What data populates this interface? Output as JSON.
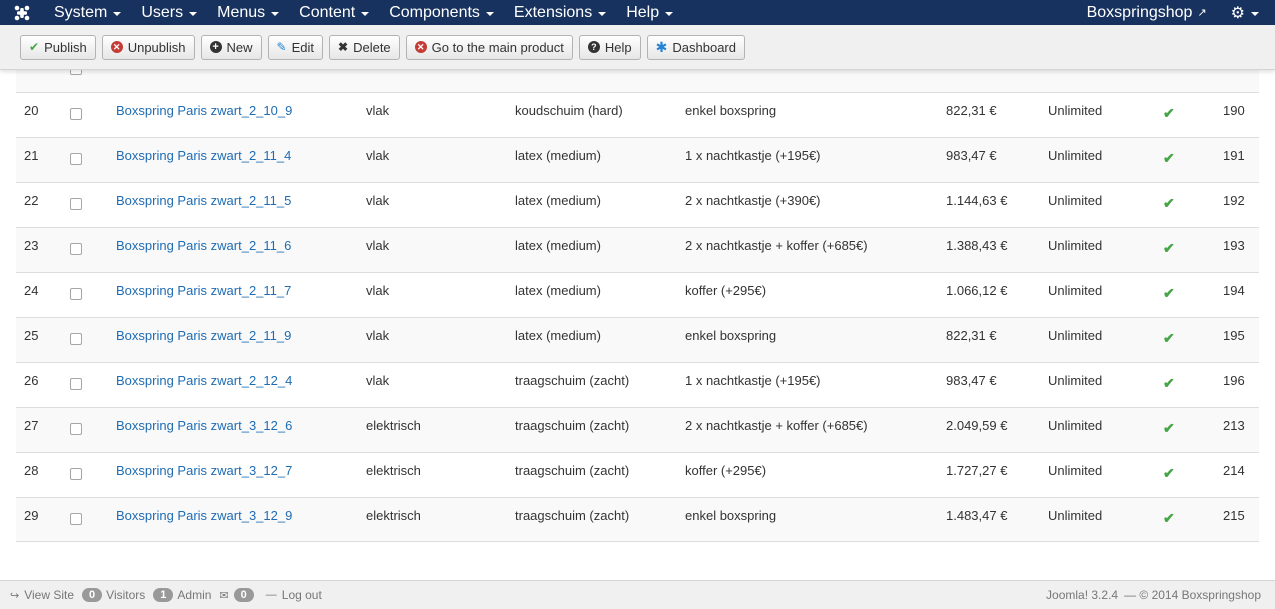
{
  "navbar": {
    "menus": [
      "System",
      "Users",
      "Menus",
      "Content",
      "Components",
      "Extensions",
      "Help"
    ],
    "site_name": "Boxspringshop"
  },
  "toolbar": {
    "publish": "Publish",
    "unpublish": "Unpublish",
    "new": "New",
    "edit": "Edit",
    "delete": "Delete",
    "main_product": "Go to the main product",
    "help": "Help",
    "dashboard": "Dashboard"
  },
  "table": {
    "rows": [
      {
        "num": "20",
        "name": "Boxspring Paris zwart_2_10_9",
        "f1": "vlak",
        "f2": "koudschuim (hard)",
        "f3": "enkel boxspring",
        "price": "822,31 €",
        "stock": "Unlimited",
        "id": "190"
      },
      {
        "num": "21",
        "name": "Boxspring Paris zwart_2_11_4",
        "f1": "vlak",
        "f2": "latex (medium)",
        "f3": "1 x nachtkastje (+195€)",
        "price": "983,47 €",
        "stock": "Unlimited",
        "id": "191"
      },
      {
        "num": "22",
        "name": "Boxspring Paris zwart_2_11_5",
        "f1": "vlak",
        "f2": "latex (medium)",
        "f3": "2 x nachtkastje (+390€)",
        "price": "1.144,63 €",
        "stock": "Unlimited",
        "id": "192"
      },
      {
        "num": "23",
        "name": "Boxspring Paris zwart_2_11_6",
        "f1": "vlak",
        "f2": "latex (medium)",
        "f3": "2 x nachtkastje + koffer (+685€)",
        "price": "1.388,43 €",
        "stock": "Unlimited",
        "id": "193"
      },
      {
        "num": "24",
        "name": "Boxspring Paris zwart_2_11_7",
        "f1": "vlak",
        "f2": "latex (medium)",
        "f3": "koffer (+295€)",
        "price": "1.066,12 €",
        "stock": "Unlimited",
        "id": "194"
      },
      {
        "num": "25",
        "name": "Boxspring Paris zwart_2_11_9",
        "f1": "vlak",
        "f2": "latex (medium)",
        "f3": "enkel boxspring",
        "price": "822,31 €",
        "stock": "Unlimited",
        "id": "195"
      },
      {
        "num": "26",
        "name": "Boxspring Paris zwart_2_12_4",
        "f1": "vlak",
        "f2": "traagschuim (zacht)",
        "f3": "1 x nachtkastje (+195€)",
        "price": "983,47 €",
        "stock": "Unlimited",
        "id": "196"
      },
      {
        "num": "27",
        "name": "Boxspring Paris zwart_3_12_6",
        "f1": "elektrisch",
        "f2": "traagschuim (zacht)",
        "f3": "2 x nachtkastje + koffer (+685€)",
        "price": "2.049,59 €",
        "stock": "Unlimited",
        "id": "213"
      },
      {
        "num": "28",
        "name": "Boxspring Paris zwart_3_12_7",
        "f1": "elektrisch",
        "f2": "traagschuim (zacht)",
        "f3": "koffer (+295€)",
        "price": "1.727,27 €",
        "stock": "Unlimited",
        "id": "214"
      },
      {
        "num": "29",
        "name": "Boxspring Paris zwart_3_12_9",
        "f1": "elektrisch",
        "f2": "traagschuim (zacht)",
        "f3": "enkel boxspring",
        "price": "1.483,47 €",
        "stock": "Unlimited",
        "id": "215"
      }
    ]
  },
  "footer": {
    "view_site": "View Site",
    "visitors_count": "0",
    "visitors_label": "Visitors",
    "admin_count": "1",
    "admin_label": "Admin",
    "messages_count": "0",
    "logout": "Log out",
    "version": "Joomla! 3.2.4",
    "copyright": "— © 2014 Boxspringshop"
  },
  "colors": {
    "navbar": "#17325e",
    "link": "#1f6cb3",
    "published": "#46a546"
  }
}
